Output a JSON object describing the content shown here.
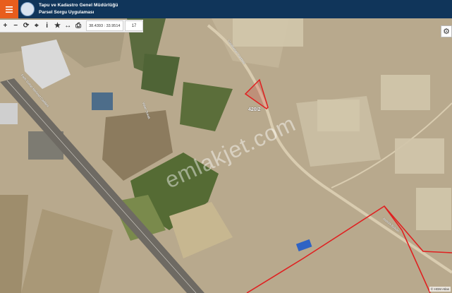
{
  "header": {
    "title_line1": "Tapu ve Kadastro Genel Müdürlüğü",
    "title_line2": "Parsel Sorgu Uygulaması"
  },
  "toolbar": {
    "coordinates": "38.4393 : 33.9514",
    "zoom_level": "17"
  },
  "map": {
    "parcel_label": "420/2",
    "watermark": "emlakjet.com",
    "attribution": "© HGM Atlas",
    "street_labels": [
      "Fatih Sultan Mehmet Caddesi",
      "Vatan Sokak",
      "Cumhuriyet Caddesi",
      "Atatürk Bulvarı"
    ]
  },
  "icons": [
    "menu-icon",
    "zoom-in-icon",
    "zoom-out-icon",
    "refresh-icon",
    "locate-icon",
    "info-icon",
    "favorite-icon",
    "measure-icon",
    "print-icon",
    "settings-icon"
  ],
  "colors": {
    "header_bg": "#10355a",
    "menu_accent": "#e85d1d",
    "parcel_outline": "#e02020"
  }
}
